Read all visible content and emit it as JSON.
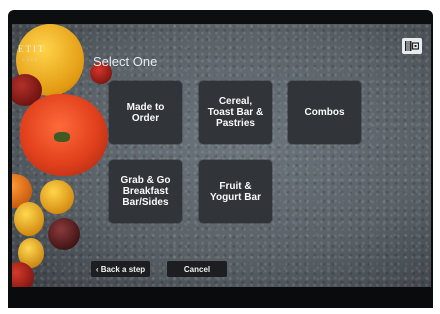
{
  "brand": {
    "name": "ETIT",
    "tagline": "CAFE"
  },
  "page": {
    "title": "Select One"
  },
  "menu": {
    "tiles": [
      {
        "label": "Made to\nOrder"
      },
      {
        "label": "Cereal,\nToast Bar &\nPastries"
      },
      {
        "label": "Combos"
      },
      {
        "label": "Grab & Go\nBreakfast\nBar/Sides"
      },
      {
        "label": "Fruit &\nYogurt Bar"
      }
    ]
  },
  "footer": {
    "back_label": "‹ Back a step",
    "cancel_label": "Cancel"
  },
  "colors": {
    "tile_bg": "#31353a",
    "button_bg": "#1c1e21",
    "screen_bg": "#606970"
  },
  "icons": [
    "qr-scan-icon"
  ]
}
